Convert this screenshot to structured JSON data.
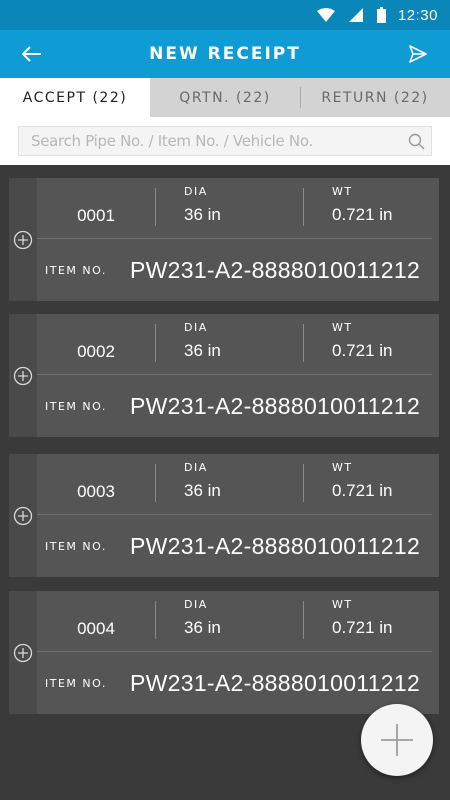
{
  "status_bar": {
    "time": "12:30"
  },
  "app_bar": {
    "title": "NEW RECEIPT"
  },
  "tabs": [
    {
      "label": "ACCEPT (22)",
      "active": true
    },
    {
      "label": "QRTN. (22)",
      "active": false
    },
    {
      "label": "RETURN (22)",
      "active": false
    }
  ],
  "search": {
    "placeholder": "Search Pipe No. / Item No. / Vehicle No.",
    "value": ""
  },
  "field_labels": {
    "dia": "DIA",
    "wt": "WT",
    "item_no": "ITEM NO."
  },
  "cards": [
    {
      "number": "0001",
      "dia": "36 in",
      "wt": "0.721 in",
      "item_no": "PW231-A2-8888010011212"
    },
    {
      "number": "0002",
      "dia": "36 in",
      "wt": "0.721 in",
      "item_no": "PW231-A2-8888010011212"
    },
    {
      "number": "0003",
      "dia": "36 in",
      "wt": "0.721 in",
      "item_no": "PW231-A2-8888010011212"
    },
    {
      "number": "0004",
      "dia": "36 in",
      "wt": "0.721 in",
      "item_no": "PW231-A2-8888010011212"
    }
  ],
  "colors": {
    "status_bar": "#0a86b8",
    "app_bar": "#0f9cd4",
    "card": "#555555",
    "background": "#3a3a3a"
  }
}
